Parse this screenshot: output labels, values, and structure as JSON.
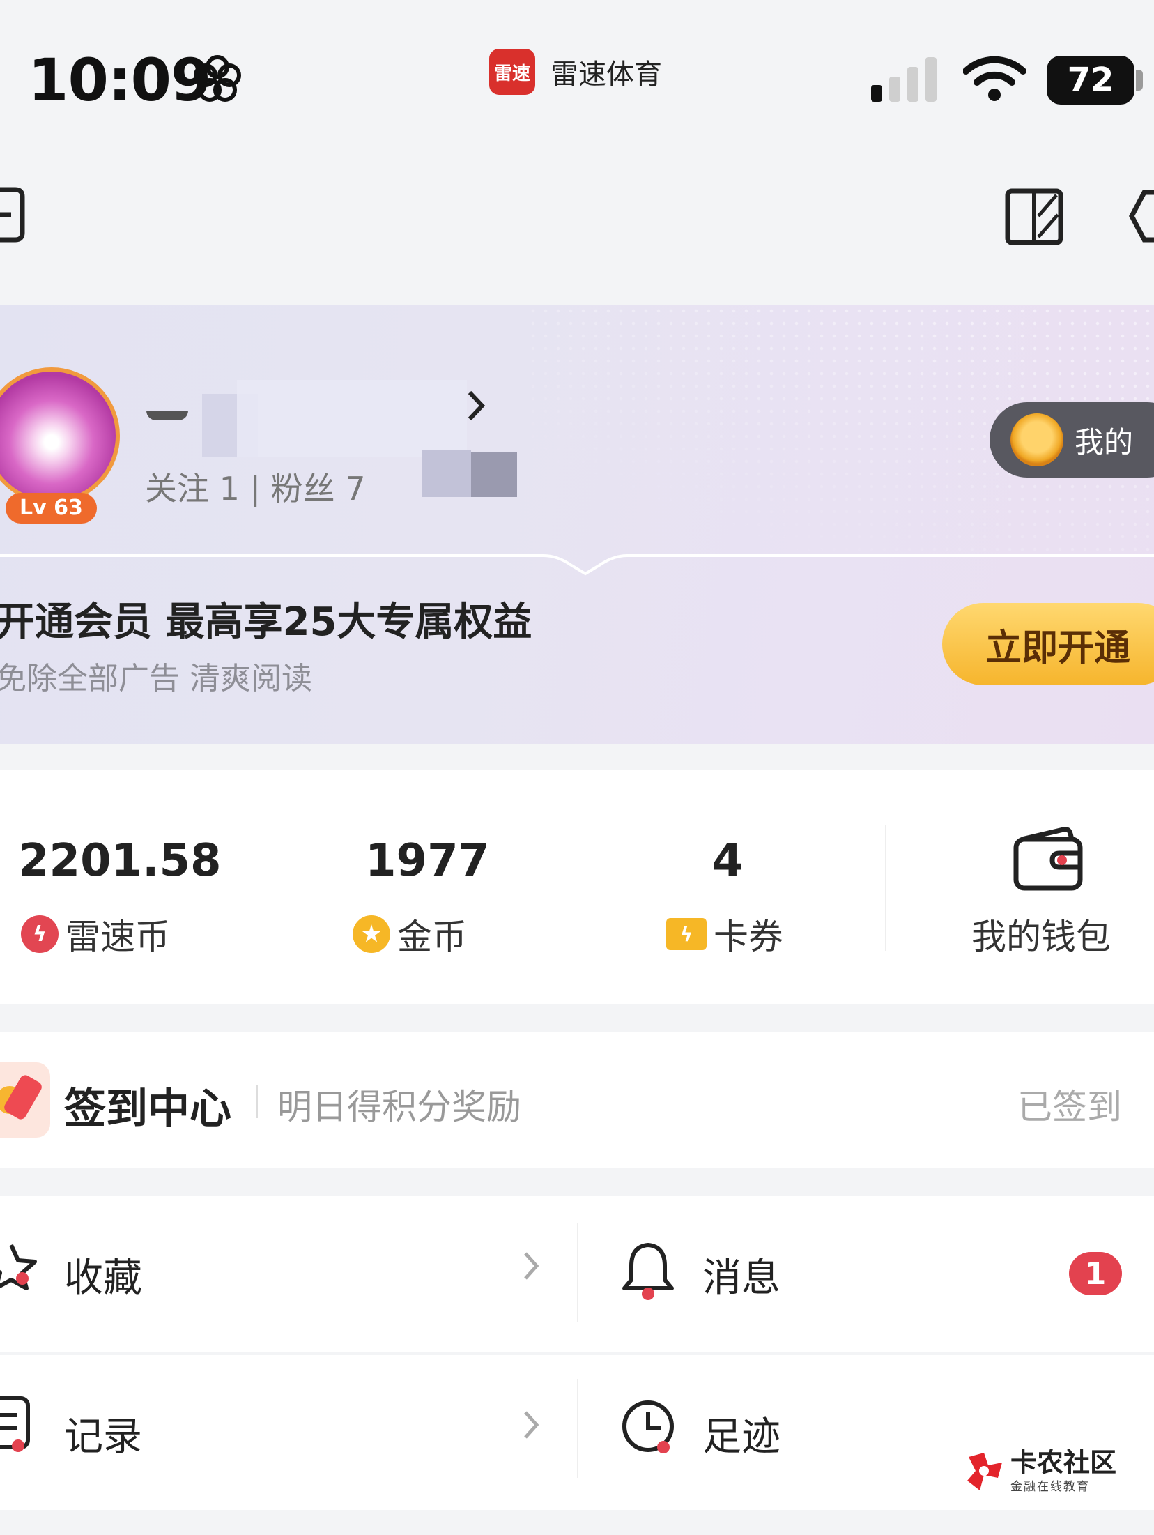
{
  "status_bar": {
    "time": "10:09",
    "notification_app_icon_text": "雷速",
    "notification_app_name": "雷速体育",
    "battery": "72"
  },
  "profile": {
    "level": "Lv 63",
    "follow_stats": "关注 1 | 粉丝 7",
    "badge_label": "我的",
    "avatar_border_color": "#f19a3e"
  },
  "vip": {
    "title": "开通会员 最高享25大专属权益",
    "subtitle": "免除全部广告 清爽阅读",
    "button_label": "立即开通",
    "button_color": "#f6b52d"
  },
  "wallet": {
    "items": [
      {
        "value": "2201.58",
        "label": "雷速币",
        "icon": "red-lightning-coin-icon"
      },
      {
        "value": "1977",
        "label": "金币",
        "icon": "gold-star-coin-icon"
      },
      {
        "value": "4",
        "label": "卡券",
        "icon": "ticket-icon"
      }
    ],
    "my_wallet_label": "我的钱包"
  },
  "signin": {
    "title": "签到中心",
    "description": "明日得积分奖励",
    "status": "已签到"
  },
  "menu": {
    "items": [
      {
        "label": "收藏",
        "icon": "star-icon"
      },
      {
        "label": "消息",
        "icon": "bell-icon",
        "badge": "1"
      },
      {
        "label": "记录",
        "icon": "list-icon"
      },
      {
        "label": "足迹",
        "icon": "clock-icon"
      }
    ]
  },
  "watermark": {
    "title": "卡农社区",
    "subtitle": "金融在线教育"
  },
  "colors": {
    "accent_red": "#e3424f",
    "accent_gold": "#f6b726"
  }
}
